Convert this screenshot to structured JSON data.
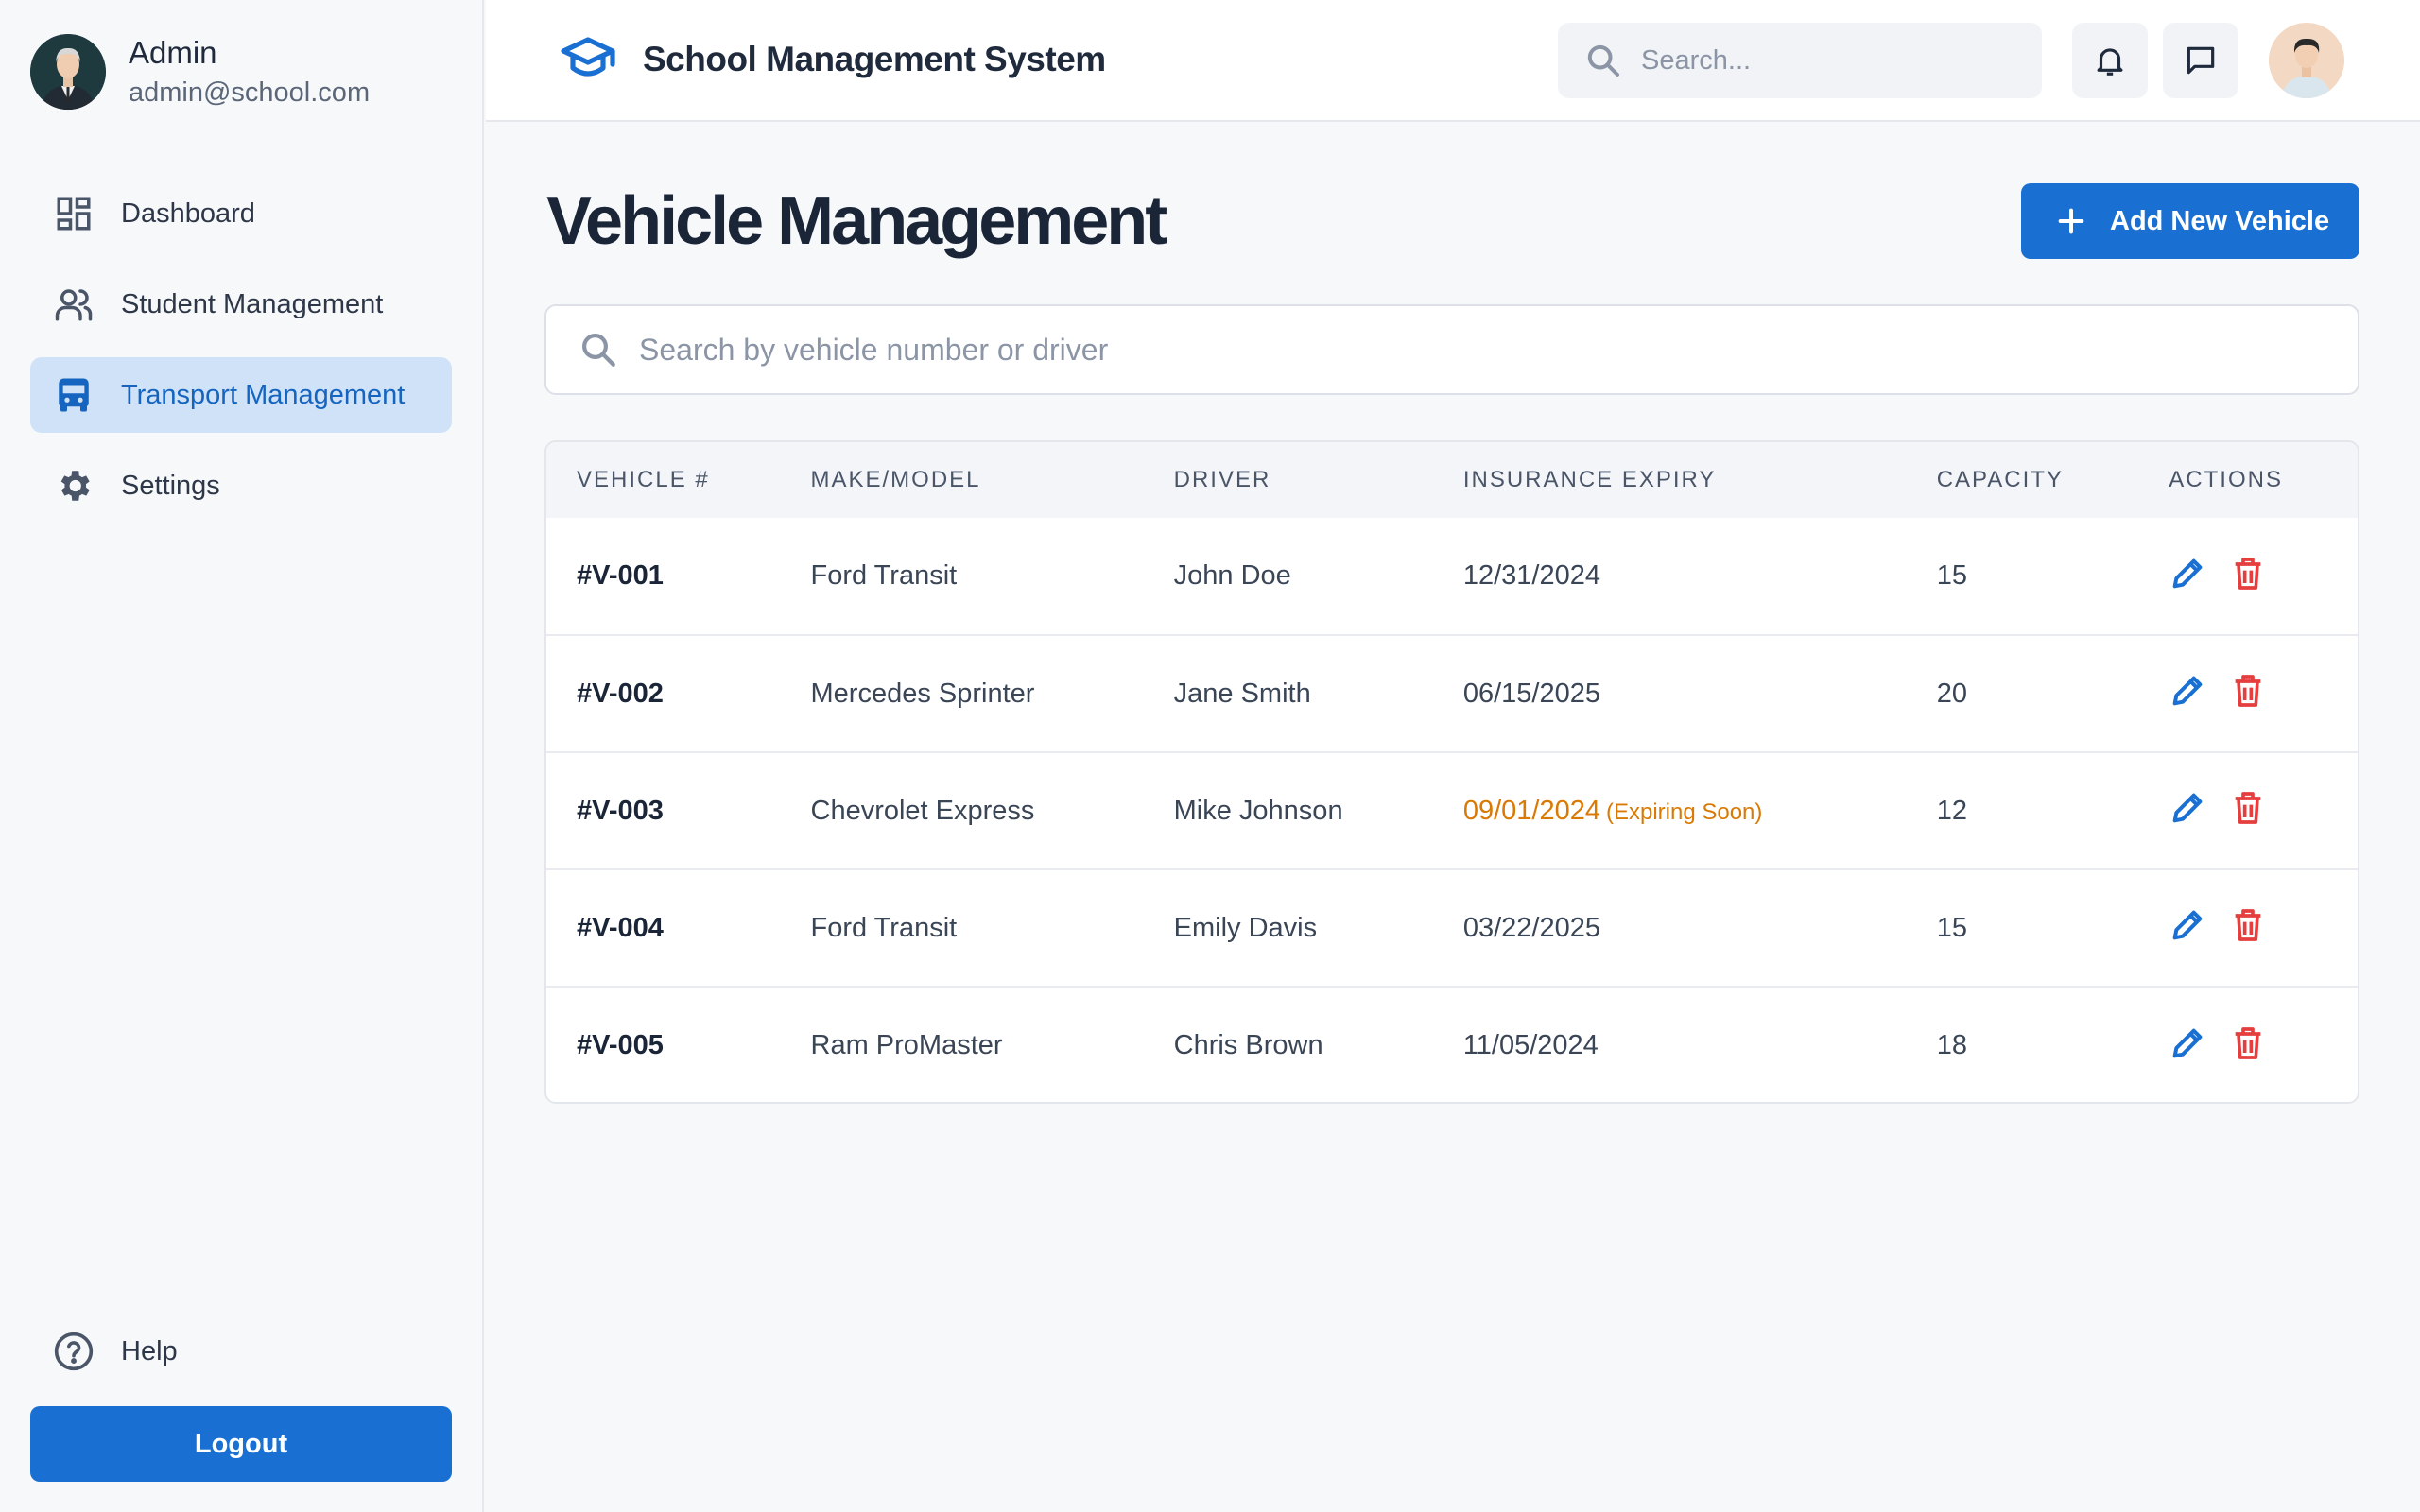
{
  "sidebar": {
    "profile": {
      "name": "Admin",
      "email": "admin@school.com"
    },
    "items": [
      {
        "label": "Dashboard",
        "icon": "dashboard-icon",
        "active": false
      },
      {
        "label": "Student Management",
        "icon": "users-icon",
        "active": false
      },
      {
        "label": "Transport Management",
        "icon": "bus-icon",
        "active": true
      },
      {
        "label": "Settings",
        "icon": "gear-icon",
        "active": false
      }
    ],
    "help_label": "Help",
    "logout_label": "Logout"
  },
  "header": {
    "title": "School Management System",
    "search_placeholder": "Search..."
  },
  "main": {
    "title": "Vehicle Management",
    "add_button_label": "Add New Vehicle",
    "table_search_placeholder": "Search by vehicle number or driver",
    "columns": [
      "VEHICLE #",
      "MAKE/MODEL",
      "DRIVER",
      "INSURANCE EXPIRY",
      "CAPACITY",
      "ACTIONS"
    ],
    "rows": [
      {
        "vehicle": "#V-001",
        "model": "Ford Transit",
        "driver": "John Doe",
        "expiry": "12/31/2024",
        "note": "",
        "capacity": "15"
      },
      {
        "vehicle": "#V-002",
        "model": "Mercedes Sprinter",
        "driver": "Jane Smith",
        "expiry": "06/15/2025",
        "note": "",
        "capacity": "20"
      },
      {
        "vehicle": "#V-003",
        "model": "Chevrolet Express",
        "driver": "Mike Johnson",
        "expiry": "09/01/2024",
        "note": "(Expiring Soon)",
        "capacity": "12"
      },
      {
        "vehicle": "#V-004",
        "model": "Ford Transit",
        "driver": "Emily Davis",
        "expiry": "03/22/2025",
        "note": "",
        "capacity": "15"
      },
      {
        "vehicle": "#V-005",
        "model": "Ram ProMaster",
        "driver": "Chris Brown",
        "expiry": "11/05/2024",
        "note": "",
        "capacity": "18"
      }
    ]
  },
  "colors": {
    "accent": "#1970d2",
    "active_nav_bg": "#cfe2f7",
    "warning": "#d97a06",
    "danger": "#e53e3e"
  }
}
